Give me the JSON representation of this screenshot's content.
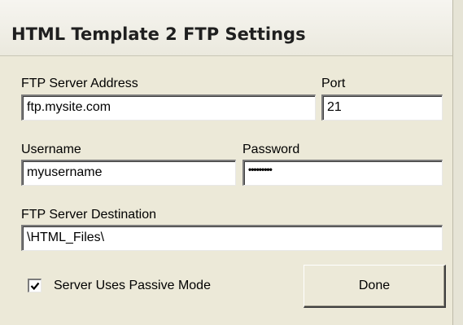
{
  "window": {
    "title": "HTML Template 2 FTP Settings"
  },
  "form": {
    "server_address": {
      "label": "FTP Server Address",
      "value": "ftp.mysite.com"
    },
    "port": {
      "label": "Port",
      "value": "21"
    },
    "username": {
      "label": "Username",
      "value": "myusername"
    },
    "password": {
      "label": "Password",
      "value": "•••••••••"
    },
    "destination": {
      "label": "FTP Server Destination",
      "value": "\\HTML_Files\\"
    },
    "passive_mode": {
      "label": "Server Uses Passive Mode",
      "checked": true
    },
    "done_label": "Done"
  },
  "colors": {
    "dialog_bg": "#ece9d8",
    "field_bg": "#ffffff"
  }
}
